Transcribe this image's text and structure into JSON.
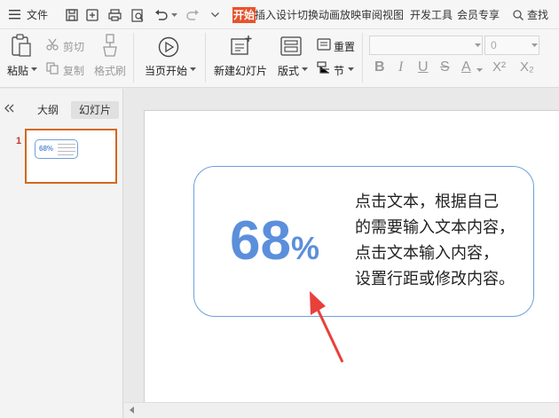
{
  "menu": {
    "file_label": "文件",
    "tabs": [
      "开始",
      "插入",
      "设计",
      "切换",
      "动画",
      "放映",
      "审阅",
      "视图",
      "开发工具",
      "会员专享"
    ],
    "active_tab_color": "#e8532c",
    "search_label": "查找"
  },
  "ribbon": {
    "paste": "粘贴",
    "cut": "剪切",
    "copy": "复制",
    "format_painter": "格式刷",
    "play_from_current": "当页开始",
    "new_slide": "新建幻灯片",
    "layout": "版式",
    "reset": "重置",
    "section": "节",
    "font_size_value": "0",
    "font_buttons": [
      "B",
      "I",
      "U",
      "S",
      "A",
      "X²",
      "X₂"
    ]
  },
  "left_panel": {
    "tabs": [
      "大纲",
      "幻灯片"
    ],
    "active_tab": "幻灯片",
    "slide_number": "1",
    "thumb_percent": "68%"
  },
  "slide": {
    "percent_number": "68",
    "percent_symbol": "%",
    "text_lines": [
      "点击文本，根据自己",
      "的需要输入文本内容，",
      "点击文本输入内容，",
      "设置行距或修改内容。"
    ],
    "accent_color": "#5b8fdc",
    "arrow_color": "#e8403a"
  }
}
